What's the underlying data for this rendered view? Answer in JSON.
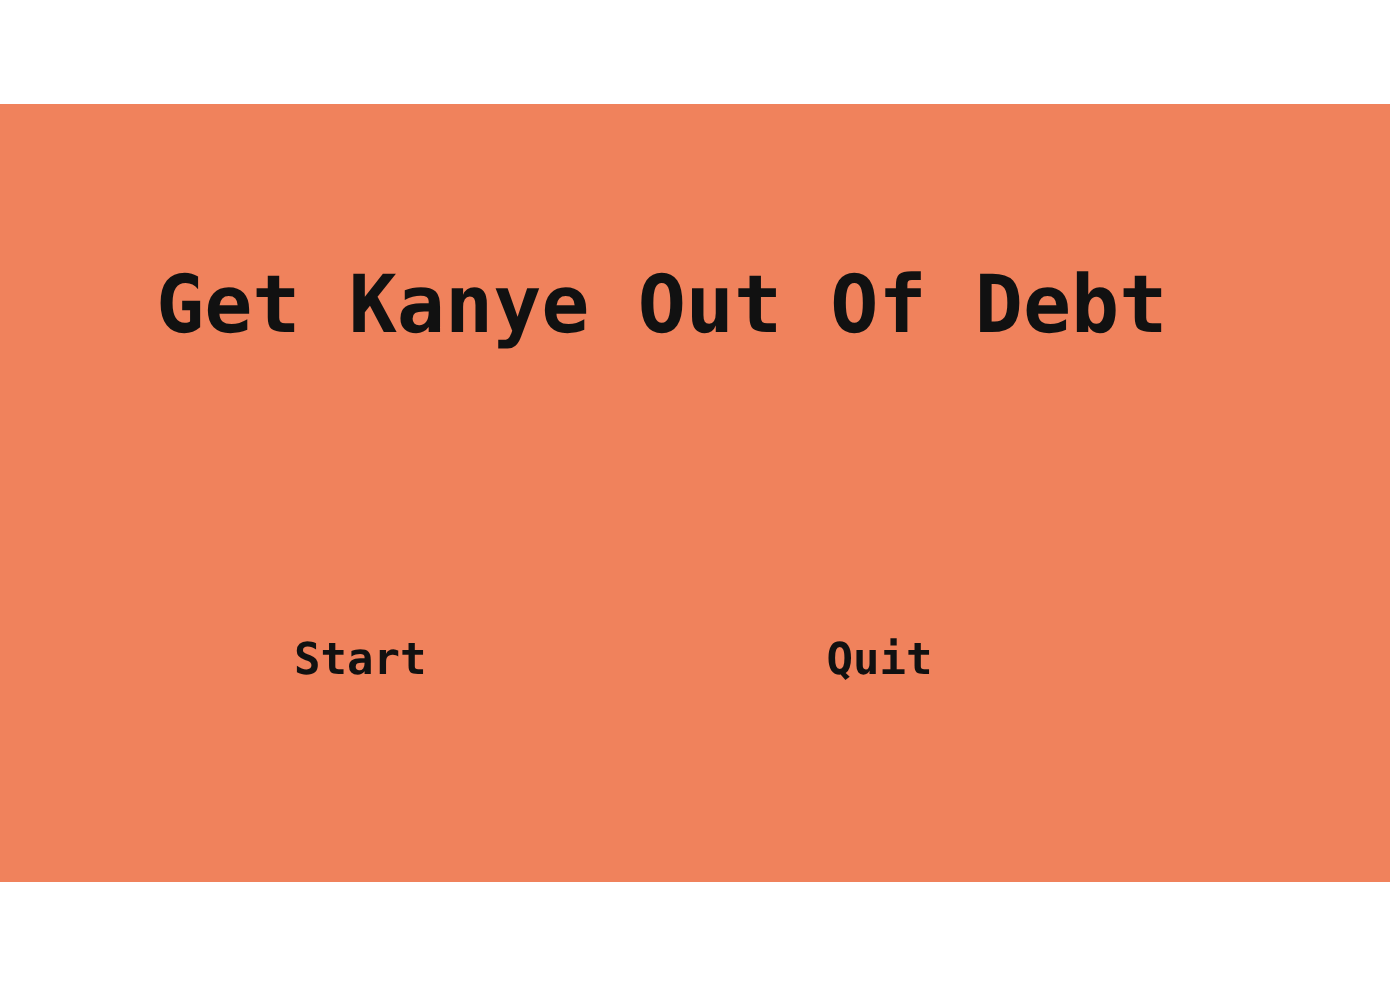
{
  "title": "Get Kanye Out Of Debt",
  "buttons": [
    {
      "label": "Start"
    },
    {
      "label": "Quit"
    }
  ]
}
